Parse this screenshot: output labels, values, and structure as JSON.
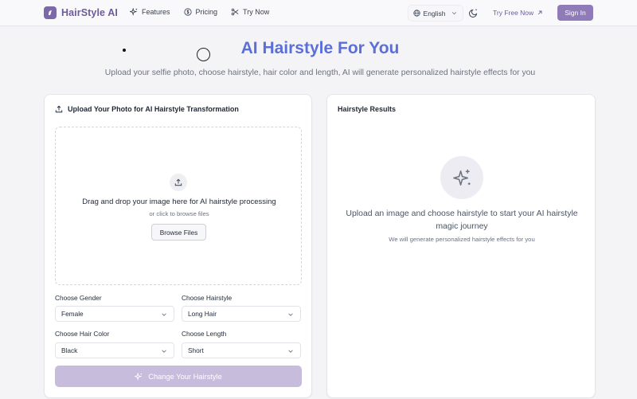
{
  "header": {
    "brand": "HairStyle AI",
    "nav": [
      {
        "label": "Features",
        "icon": "sparkles-icon"
      },
      {
        "label": "Pricing",
        "icon": "dollar-icon"
      },
      {
        "label": "Try Now",
        "icon": "scissors-icon"
      }
    ],
    "language": "English",
    "try_free": "Try Free Now",
    "sign_in": "Sign In"
  },
  "hero": {
    "title": "AI Hairstyle For You",
    "subtitle": "Upload your selfie photo, choose hairstyle, hair color and length, AI will generate personalized hairstyle effects for you"
  },
  "upload_panel": {
    "title": "Upload Your Photo for AI Hairstyle Transformation",
    "drop_title": "Drag and drop your image here for AI hairstyle processing",
    "drop_sub": "or click to browse files",
    "browse_label": "Browse Files",
    "fields": {
      "gender": {
        "label": "Choose Gender",
        "value": "Female"
      },
      "hairstyle": {
        "label": "Choose Hairstyle",
        "value": "Long Hair"
      },
      "color": {
        "label": "Choose Hair Color",
        "value": "Black"
      },
      "length": {
        "label": "Choose Length",
        "value": "Short"
      }
    },
    "submit_label": "Change Your Hairstyle"
  },
  "results_panel": {
    "title": "Hairstyle Results",
    "empty_title": "Upload an image and choose hairstyle to start your AI hairstyle magic journey",
    "empty_sub": "We will generate personalized hairstyle effects for you"
  },
  "colors": {
    "brand": "#6d5a9c",
    "accent": "#5b6fd6",
    "button": "#8e7bb8",
    "button_disabled": "#c7bcdb"
  }
}
